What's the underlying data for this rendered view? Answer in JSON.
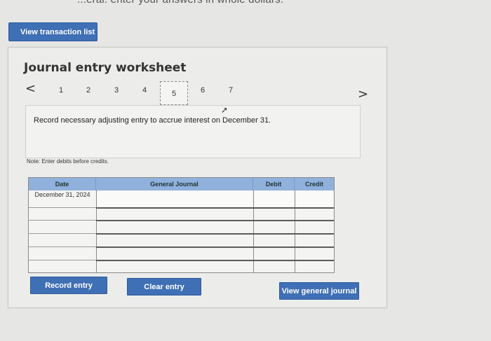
{
  "header": {
    "top_text": "...eral. enter your answers in whole dollars."
  },
  "toolbar": {
    "view_transaction_list": "View transaction list"
  },
  "worksheet": {
    "title": "Journal entry worksheet",
    "pager": {
      "prev": "<",
      "next": ">",
      "pages": [
        "1",
        "2",
        "3",
        "4",
        "5",
        "6",
        "7"
      ],
      "active": "5"
    },
    "instruction": "Record necessary adjusting entry to accrue interest on December 31.",
    "note": "Note: Enter debits before credits.",
    "table": {
      "headers": {
        "date": "Date",
        "journal": "General Journal",
        "debit": "Debit",
        "credit": "Credit"
      },
      "first_date": "December 31, 2024",
      "row_count": 6
    }
  },
  "actions": {
    "record_entry": "Record entry",
    "clear_entry": "Clear entry",
    "view_general_journal": "View general journal"
  },
  "colors": {
    "button_blue": "#3f6fb5",
    "header_blue": "#8fb1dc"
  }
}
